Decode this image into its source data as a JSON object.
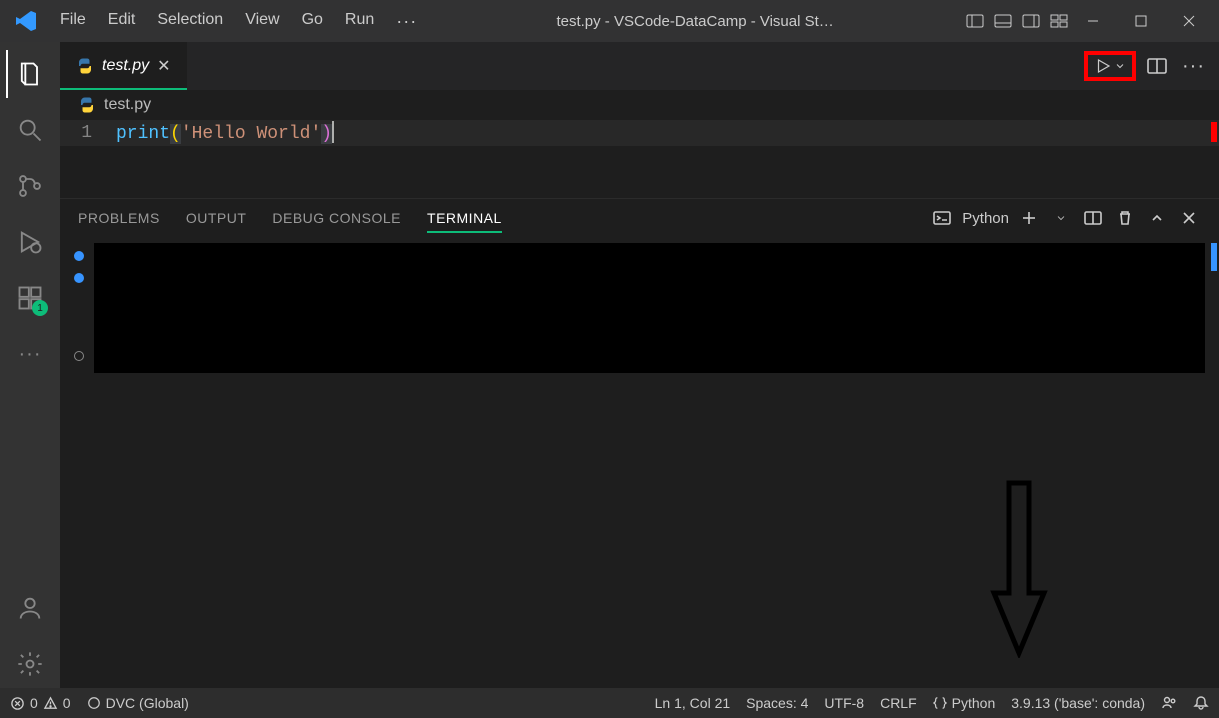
{
  "titlebar": {
    "menu": [
      "File",
      "Edit",
      "Selection",
      "View",
      "Go",
      "Run"
    ],
    "window_title": "test.py - VSCode-DataCamp - Visual St…"
  },
  "activitybar": {
    "items": [
      {
        "name": "explorer"
      },
      {
        "name": "search"
      },
      {
        "name": "source-control"
      },
      {
        "name": "run-debug"
      },
      {
        "name": "extensions",
        "badge": "1"
      }
    ]
  },
  "tabs": {
    "open": [
      {
        "label": "test.py",
        "lang": "python",
        "dirty": false
      }
    ]
  },
  "breadcrumb": {
    "file": "test.py"
  },
  "editor": {
    "lines": [
      {
        "num": "1",
        "tokens": [
          {
            "cls": "tok-fn",
            "text": "print"
          },
          {
            "cls": "tok-br1",
            "text": "("
          },
          {
            "cls": "tok-str",
            "text": "'Hello World'"
          },
          {
            "cls": "tok-br2",
            "text": ")"
          }
        ]
      }
    ]
  },
  "panel": {
    "tabs": [
      "PROBLEMS",
      "OUTPUT",
      "DEBUG CONSOLE",
      "TERMINAL"
    ],
    "active_tab": "TERMINAL",
    "profile": "Python"
  },
  "statusbar": {
    "errors": "0",
    "warnings": "0",
    "dvc": "DVC (Global)",
    "position": "Ln 1, Col 21",
    "spaces": "Spaces: 4",
    "encoding": "UTF-8",
    "eol": "CRLF",
    "lang": "Python",
    "interpreter": "3.9.13 ('base': conda)"
  }
}
